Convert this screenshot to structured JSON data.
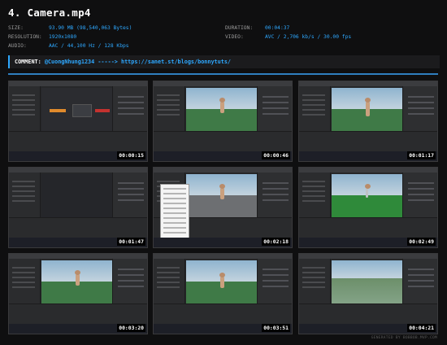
{
  "title": "4. Camera.mp4",
  "meta": {
    "size_label": "SIZE:",
    "size_value": "93.90 MB (98,540,063 Bytes)",
    "resolution_label": "RESOLUTION:",
    "resolution_value": "1920x1080",
    "audio_label": "AUDIO:",
    "audio_value": "AAC / 44,100 Hz / 128 Kbps",
    "duration_label": "DURATION:",
    "duration_value": "00:04:37",
    "video_label": "VIDEO:",
    "video_value": "AVC / 2,706 kb/s / 30.00 fps"
  },
  "comment": {
    "label": "COMMENT:",
    "user": "@CuongNhung1234",
    "arrow": "----->",
    "url": "https://sanet.st/blogs/bonnytuts/"
  },
  "thumbnails": [
    {
      "timestamp": "00:00:15",
      "scene": "blueprint"
    },
    {
      "timestamp": "00:00:46",
      "scene": "viewport"
    },
    {
      "timestamp": "00:01:17",
      "scene": "viewport"
    },
    {
      "timestamp": "00:01:47",
      "scene": "dark"
    },
    {
      "timestamp": "00:02:18",
      "scene": "popup"
    },
    {
      "timestamp": "00:02:49",
      "scene": "viewport"
    },
    {
      "timestamp": "00:03:20",
      "scene": "viewport"
    },
    {
      "timestamp": "00:03:51",
      "scene": "viewport"
    },
    {
      "timestamp": "00:04:21",
      "scene": "viewport"
    }
  ],
  "footer": "GENERATED BY BOBBOB.MVP.COM",
  "colors": {
    "accent": "#2ea8ff",
    "background": "#0f0f10",
    "rule": "#2f7fbf"
  }
}
